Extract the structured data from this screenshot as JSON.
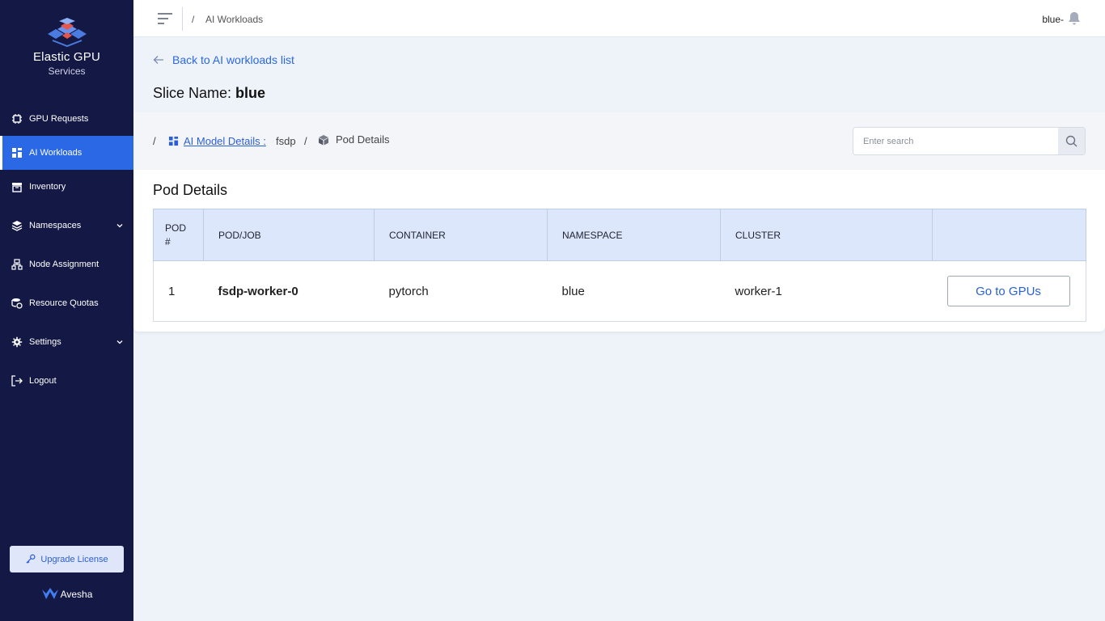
{
  "brand": {
    "title": "Elastic GPU",
    "subtitle": "Services"
  },
  "nav": [
    {
      "label": "GPU Requests"
    },
    {
      "label": "AI Workloads"
    },
    {
      "label": "Inventory"
    },
    {
      "label": "Namespaces"
    },
    {
      "label": "Node Assignment"
    },
    {
      "label": "Resource Quotas"
    },
    {
      "label": "Settings"
    },
    {
      "label": "Logout"
    }
  ],
  "upgrade_label": "Upgrade License",
  "vendor": "Avesha",
  "topbar": {
    "separator": "/",
    "crumb": "AI Workloads",
    "user": "blue-"
  },
  "back_label": "Back to AI workloads list",
  "slice": {
    "prefix": "Slice Name:",
    "name": "blue"
  },
  "crumbs": {
    "sep": "/",
    "model_link": "AI Model Details :",
    "model_name": "fsdp",
    "current": "Pod Details"
  },
  "search": {
    "placeholder": "Enter search",
    "value": ""
  },
  "card_title": "Pod Details",
  "table": {
    "headers": {
      "pod_num_1": "POD",
      "pod_num_2": "#",
      "pod_job": "POD/JOB",
      "container": "CONTAINER",
      "namespace": "NAMESPACE",
      "cluster": "CLUSTER"
    },
    "rows": [
      {
        "num": "1",
        "pod_job": "fsdp-worker-0",
        "container": "pytorch",
        "namespace": "blue",
        "cluster": "worker-1",
        "action": "Go to GPUs"
      }
    ]
  },
  "colors": {
    "sidebar": "#141844",
    "active": "#2a68e6",
    "link": "#2a5fd6",
    "header_bg": "#dde7fb"
  },
  "icons": [
    "cpu-icon",
    "workloads-icon",
    "archive-icon",
    "layers-icon",
    "sitemap-icon",
    "quota-icon",
    "gear-icon",
    "logout-icon",
    "key-icon",
    "bell-icon",
    "search-icon",
    "cube-icon",
    "arrow-left-icon",
    "menu-icon"
  ]
}
